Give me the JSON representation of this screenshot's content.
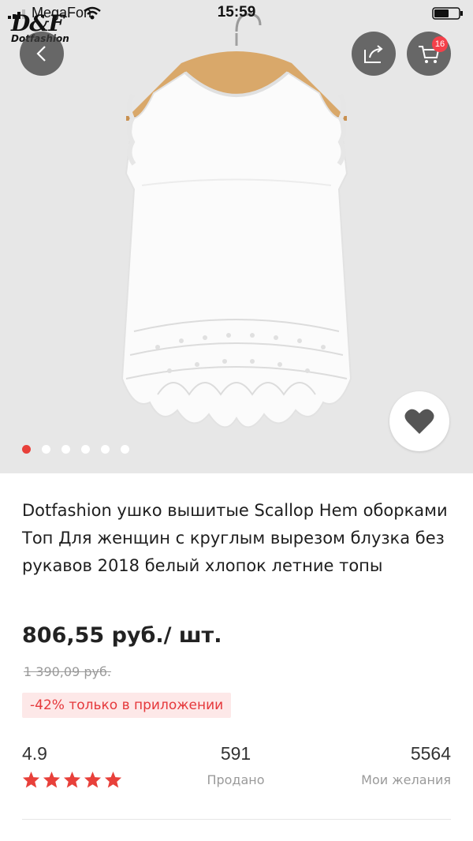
{
  "status_bar": {
    "carrier": "MegaFon",
    "time": "15:59"
  },
  "logo": {
    "main": "D&F",
    "sub": "Dotfashion"
  },
  "cart": {
    "count": "16"
  },
  "gallery": {
    "total_images": 6,
    "active_index": 0
  },
  "product": {
    "title": "Dotfashion ушко вышитые Scallop Hem оборками Топ Для женщин с круглым вырезом блузка без рукавов 2018 белый хлопок летние топы",
    "price": "806,55 руб./ шт.",
    "old_price": "1 390,09 руб.",
    "promo": "-42% только в приложении"
  },
  "stats": {
    "rating": "4.9",
    "stars": 5,
    "sold_value": "591",
    "sold_label": "Продано",
    "wish_value": "5564",
    "wish_label": "Мои желания"
  },
  "colors": {
    "accent": "#e8403a",
    "promo_bg": "#fde8e8",
    "badge": "#f5404a"
  },
  "icons": [
    "signal-icon",
    "wifi-icon",
    "battery-icon",
    "back-arrow-icon",
    "share-icon",
    "cart-icon",
    "heart-icon",
    "star-icon"
  ]
}
